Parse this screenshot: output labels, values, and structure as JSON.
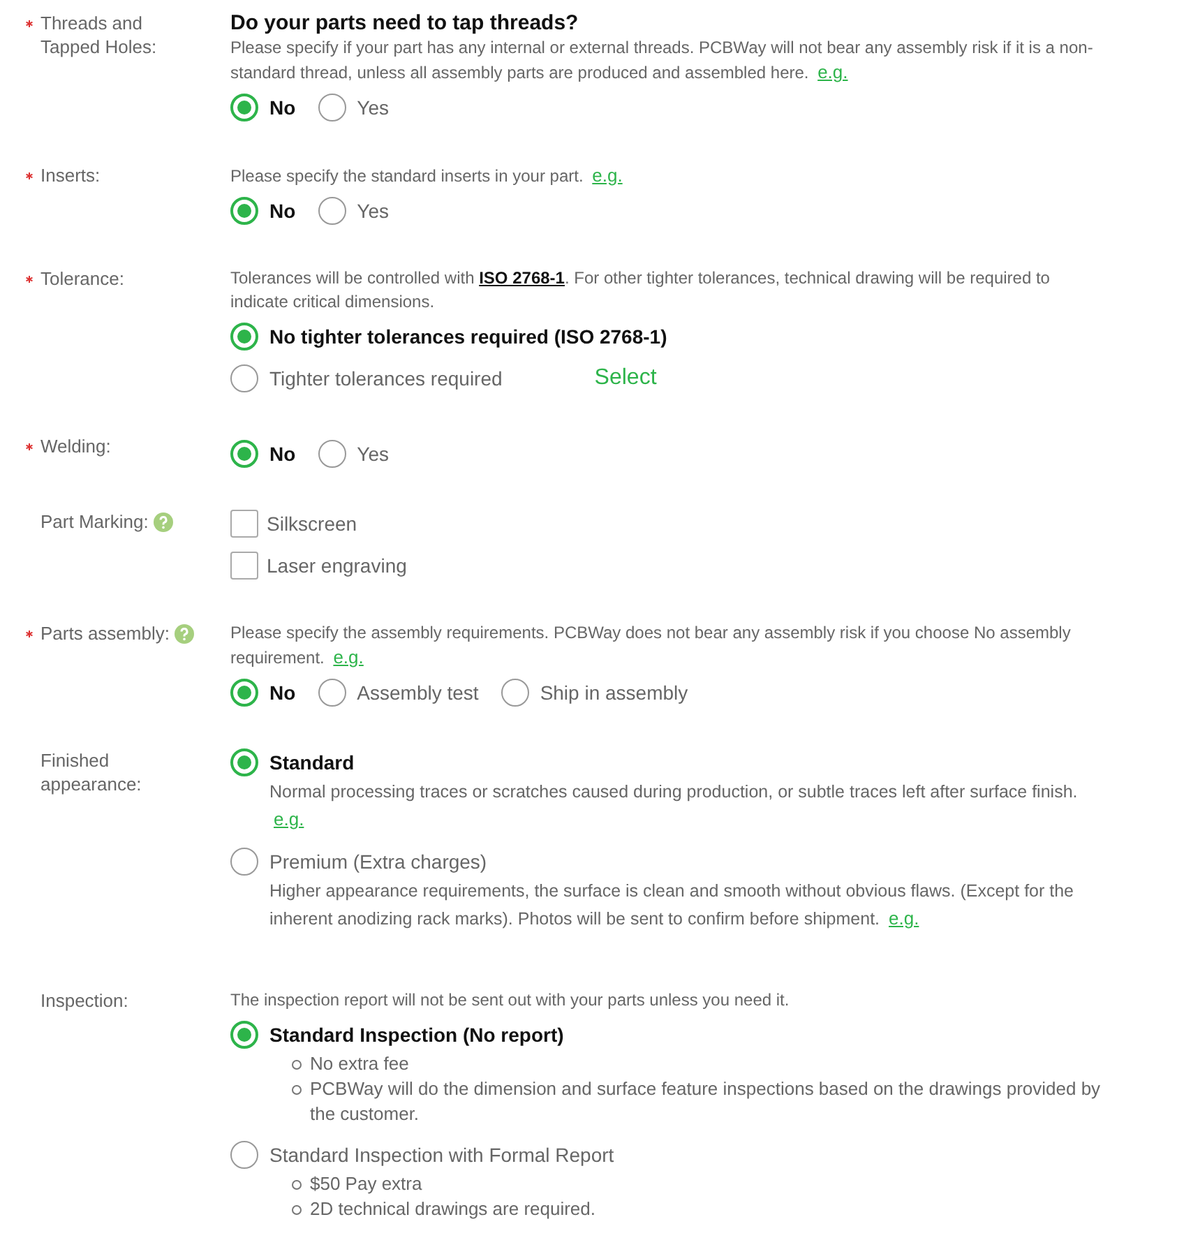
{
  "sections": [
    {
      "label": "Threads and Tapped Holes:",
      "required": true,
      "help": false,
      "heading": "Do your parts need to tap threads?",
      "note": [
        {
          "kind": "text",
          "text": "Please specify if your part has any internal or external threads. PCBWay will not bear any assembly risk if it is a non-standard thread, unless all assembly parts are produced and assembled here. "
        },
        {
          "kind": "link",
          "text": "e.g."
        }
      ],
      "kind": "inline",
      "options": [
        {
          "kind": "radio",
          "label": "No",
          "selected": true
        },
        {
          "kind": "radio",
          "label": "Yes",
          "selected": false
        }
      ]
    },
    {
      "label": "Inserts:",
      "required": true,
      "help": false,
      "note": [
        {
          "kind": "text",
          "text": "Please specify the standard inserts in your part. "
        },
        {
          "kind": "link",
          "text": "e.g."
        }
      ],
      "kind": "inline",
      "options": [
        {
          "kind": "radio",
          "label": "No",
          "selected": true
        },
        {
          "kind": "radio",
          "label": "Yes",
          "selected": false
        }
      ]
    },
    {
      "label": "Tolerance:",
      "required": true,
      "help": false,
      "note": [
        {
          "kind": "text",
          "text": "Tolerances will be controlled with "
        },
        {
          "kind": "doc",
          "text": "ISO 2768-1"
        },
        {
          "kind": "text",
          "text": ". For other tighter tolerances, technical drawing will be required to indicate critical dimensions."
        }
      ],
      "kind": "stacked",
      "options": [
        {
          "kind": "radio",
          "label": "No tighter tolerances required (ISO 2768-1)",
          "selected": true
        },
        {
          "kind": "radio",
          "label": "Tighter tolerances required",
          "selected": false,
          "action": "Select"
        }
      ]
    },
    {
      "label": "Welding:",
      "required": true,
      "help": false,
      "kind": "inline",
      "options": [
        {
          "kind": "radio",
          "label": "No",
          "selected": true
        },
        {
          "kind": "radio",
          "label": "Yes",
          "selected": false
        }
      ]
    },
    {
      "label": "Part Marking:",
      "required": false,
      "help": true,
      "kind": "stacked",
      "options": [
        {
          "kind": "checkbox",
          "label": "Silkscreen",
          "checked": false
        },
        {
          "kind": "checkbox",
          "label": "Laser engraving",
          "checked": false
        }
      ]
    },
    {
      "label": "Parts assembly:",
      "required": true,
      "help": true,
      "note": [
        {
          "kind": "text",
          "text": "Please specify the assembly requirements. PCBWay does not bear any assembly risk if you choose No assembly requirement. "
        },
        {
          "kind": "link",
          "text": "e.g."
        }
      ],
      "kind": "inline",
      "options": [
        {
          "kind": "radio",
          "label": "No",
          "selected": true
        },
        {
          "kind": "radio",
          "label": "Assembly test",
          "selected": false
        },
        {
          "kind": "radio",
          "label": "Ship in assembly",
          "selected": false
        }
      ]
    },
    {
      "label": "Finished appearance:",
      "required": false,
      "help": false,
      "kind": "stacked",
      "options": [
        {
          "kind": "radio",
          "label": "Standard",
          "selected": true,
          "description": [
            {
              "kind": "text",
              "text": "Normal processing traces or scratches caused during production, or subtle traces left after surface finish. "
            },
            {
              "kind": "link",
              "text": "e.g."
            }
          ]
        },
        {
          "kind": "radio",
          "label": "Premium (Extra charges)",
          "selected": false,
          "description": [
            {
              "kind": "text",
              "text": "Higher appearance requirements, the surface is clean and smooth without obvious flaws. (Except for the inherent anodizing rack marks). Photos will be sent to confirm before shipment. "
            },
            {
              "kind": "link",
              "text": "e.g."
            }
          ]
        }
      ]
    },
    {
      "label": "Inspection:",
      "required": false,
      "help": false,
      "note": [
        {
          "kind": "text",
          "text": "The inspection report will not be sent out with your parts unless you need it."
        }
      ],
      "kind": "stacked",
      "options": [
        {
          "kind": "radio",
          "label": "Standard Inspection (No report)",
          "selected": true,
          "bullets": [
            "No extra fee",
            "PCBWay will do the dimension and surface feature inspections based on the drawings provided by the customer."
          ]
        },
        {
          "kind": "radio",
          "label": "Standard Inspection with Formal Report",
          "selected": false,
          "bullets": [
            "$50 Pay extra",
            "2D technical drawings are required."
          ]
        }
      ]
    }
  ]
}
